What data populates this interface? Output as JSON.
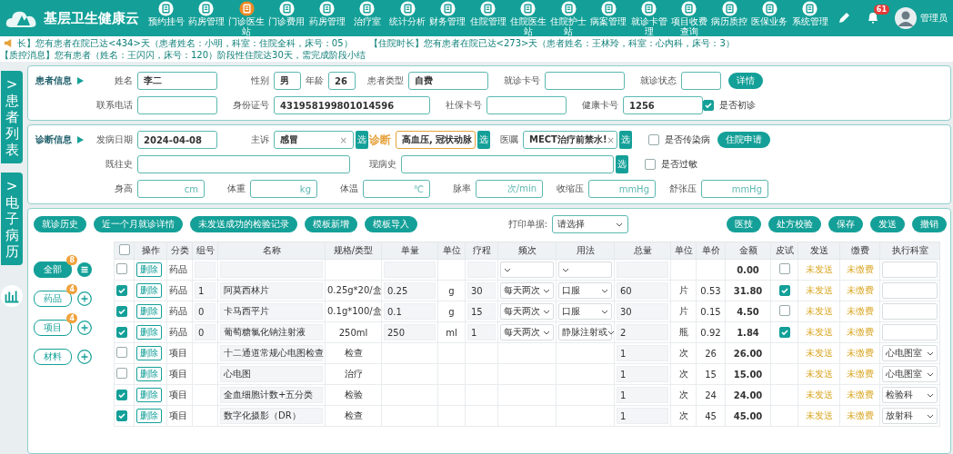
{
  "app": {
    "title": "基层卫生健康云",
    "user": "管理员",
    "notifications": "61"
  },
  "nav": [
    {
      "label": "预约挂号",
      "selected": false
    },
    {
      "label": "药房管理",
      "selected": false
    },
    {
      "label": "门诊医生站",
      "selected": true
    },
    {
      "label": "门诊费用",
      "selected": false
    },
    {
      "label": "药房管理",
      "selected": false
    },
    {
      "label": "治疗室",
      "selected": false
    },
    {
      "label": "统计分析",
      "selected": false
    },
    {
      "label": "财务管理",
      "selected": false
    },
    {
      "label": "住院管理",
      "selected": false
    },
    {
      "label": "住院医生站",
      "selected": false
    },
    {
      "label": "住院护士站",
      "selected": false
    },
    {
      "label": "病案管理",
      "selected": false
    },
    {
      "label": "就诊卡管理",
      "selected": false
    },
    {
      "label": "项目收费查询",
      "selected": false
    },
    {
      "label": "病历质控",
      "selected": false
    },
    {
      "label": "医保业务",
      "selected": false
    },
    {
      "label": "系统管理",
      "selected": false
    }
  ],
  "ticker": [
    "长】您有患者在院已达<434>天（患者姓名：小明，科室：住院全科，床号：05）",
    "【住院时长】您有患者在院已达<273>天（患者姓名：王林玲，科室：心内科，床号：3）",
    "【质控消息】您有患者（姓名：王闪闪，床号：120）阶段性住院达30天，需完成阶段小结"
  ],
  "side_tabs": [
    {
      "label": "患者列表",
      "arrow": ">"
    },
    {
      "label": "电子病历",
      "arrow": ">"
    }
  ],
  "patient": {
    "title": "患者信息",
    "name": {
      "label": "姓名",
      "value": "李二"
    },
    "gender": {
      "label": "性别",
      "value": "男"
    },
    "age": {
      "label": "年龄",
      "value": "26"
    },
    "type": {
      "label": "患者类型",
      "value": "自费"
    },
    "card_no": {
      "label": "就诊卡号"
    },
    "status": {
      "label": "就诊状态"
    },
    "detail_button": "详情",
    "phone": {
      "label": "联系电话"
    },
    "id_no": {
      "label": "身份证号",
      "value": "431958199801014596"
    },
    "social_no": {
      "label": "社保卡号"
    },
    "health_no": {
      "label": "健康卡号",
      "value": "1256"
    },
    "first_visit": {
      "label": "是否初诊",
      "checked": true
    }
  },
  "diagnosis": {
    "title": "诊断信息",
    "onset": {
      "label": "发病日期",
      "value": "2024-04-08"
    },
    "complaint": {
      "label": "主诉",
      "value": "感冒",
      "clear": "×",
      "pick": "选"
    },
    "diagnosis": {
      "label": "诊断",
      "value": "高血压, 冠状动脉",
      "pick": "选"
    },
    "order": {
      "label": "医嘱",
      "value": "MECT治疗前禁水!",
      "clear": "×",
      "pick": "选"
    },
    "infectious": {
      "label": "是否传染病",
      "checked": false
    },
    "admit_button": "住院申请",
    "history": {
      "label": "既往史"
    },
    "present": {
      "label": "现病史",
      "pick": "选"
    },
    "allergy": {
      "label": "是否过敏",
      "checked": false
    },
    "vitals": [
      {
        "label": "身高",
        "unit": "cm"
      },
      {
        "label": "体重",
        "unit": "kg"
      },
      {
        "label": "体温",
        "unit": "℃"
      },
      {
        "label": "脉率",
        "unit": "次/min"
      },
      {
        "label": "收缩压",
        "unit": "mmHg"
      },
      {
        "label": "舒张压",
        "unit": "mmHg"
      }
    ]
  },
  "toolbar": {
    "left": [
      "就诊历史",
      "近一个月就诊详情",
      "未发送成功的检验记录",
      "模板新增",
      "模板导入"
    ],
    "print_label": "打印单据:",
    "print_select": "请选择",
    "right": [
      "医技",
      "处方校验",
      "保存",
      "发送",
      "撤销"
    ]
  },
  "categories": [
    {
      "label": "全部",
      "badge": "8",
      "selected": true,
      "kind": "list"
    },
    {
      "label": "药品",
      "badge": "4",
      "selected": false,
      "kind": "add"
    },
    {
      "label": "项目",
      "badge": "4",
      "selected": false,
      "kind": "add"
    },
    {
      "label": "材料",
      "selected": false,
      "kind": "add"
    }
  ],
  "table": {
    "all_checked": false,
    "columns": [
      "操作",
      "分类",
      "组号",
      "名称",
      "规格/类型",
      "单量",
      "单位",
      "疗程",
      "频次",
      "用法",
      "总量",
      "单位",
      "单价",
      "金额",
      "皮试",
      "发送",
      "缴费",
      "执行科室"
    ],
    "rows": [
      {
        "kind": "drug",
        "checked": false,
        "action": "删除",
        "category": "药品",
        "amount": "0.00",
        "skin_test": false,
        "send": "未发送",
        "pay": "未缴费"
      },
      {
        "kind": "drug",
        "checked": true,
        "action": "删除",
        "category": "药品",
        "group": "1",
        "name": "阿莫西林片",
        "spec": "0.25g*20/盒",
        "dose": "0.25",
        "unit": "g",
        "course": "30",
        "frequency": "每天两次",
        "usage": "口服",
        "total": "60",
        "total_unit": "片",
        "price": "0.53",
        "amount": "31.80",
        "skin_test": true,
        "send": "未发送",
        "pay": "未缴费"
      },
      {
        "kind": "drug",
        "checked": true,
        "action": "删除",
        "category": "药品",
        "group": "0",
        "name": "卡马西平片",
        "spec": "0.1g*100/盒",
        "dose": "0.1",
        "unit": "g",
        "course": "15",
        "frequency": "每天两次",
        "usage": "口服",
        "total": "30",
        "total_unit": "片",
        "price": "0.15",
        "amount": "4.50",
        "skin_test": false,
        "send": "未发送",
        "pay": "未缴费"
      },
      {
        "kind": "drug",
        "checked": true,
        "action": "删除",
        "category": "药品",
        "group": "0",
        "name": "葡萄糖氯化钠注射液",
        "spec": "250ml",
        "dose": "250",
        "unit": "ml",
        "course": "1",
        "frequency": "每天两次",
        "usage": "静脉注射或",
        "total": "2",
        "total_unit": "瓶",
        "price": "0.92",
        "amount": "1.84",
        "skin_test": true,
        "send": "未发送",
        "pay": "未缴费"
      },
      {
        "kind": "item",
        "checked": false,
        "action": "删除",
        "category": "项目",
        "name": "十二通道常规心电图检查",
        "spec": "检查",
        "total": "1",
        "total_unit": "次",
        "price": "26",
        "amount": "26.00",
        "send": "未发送",
        "pay": "未缴费",
        "department": "心电图室"
      },
      {
        "kind": "item",
        "checked": false,
        "action": "删除",
        "category": "项目",
        "name": "心电图",
        "spec": "治疗",
        "total": "1",
        "total_unit": "次",
        "price": "15",
        "amount": "15.00",
        "send": "未发送",
        "pay": "未缴费",
        "department": "心电图室"
      },
      {
        "kind": "item",
        "checked": true,
        "action": "删除",
        "category": "项目",
        "name": "全血细胞计数+五分类",
        "spec": "检验",
        "total": "1",
        "total_unit": "次",
        "price": "24",
        "amount": "24.00",
        "send": "未发送",
        "pay": "未缴费",
        "department": "检验科"
      },
      {
        "kind": "item",
        "checked": true,
        "action": "删除",
        "category": "项目",
        "name": "数字化摄影（DR）",
        "spec": "检查",
        "total": "1",
        "total_unit": "次",
        "price": "45",
        "amount": "45.00",
        "send": "未发送",
        "pay": "未缴费",
        "department": "放射科"
      }
    ]
  }
}
